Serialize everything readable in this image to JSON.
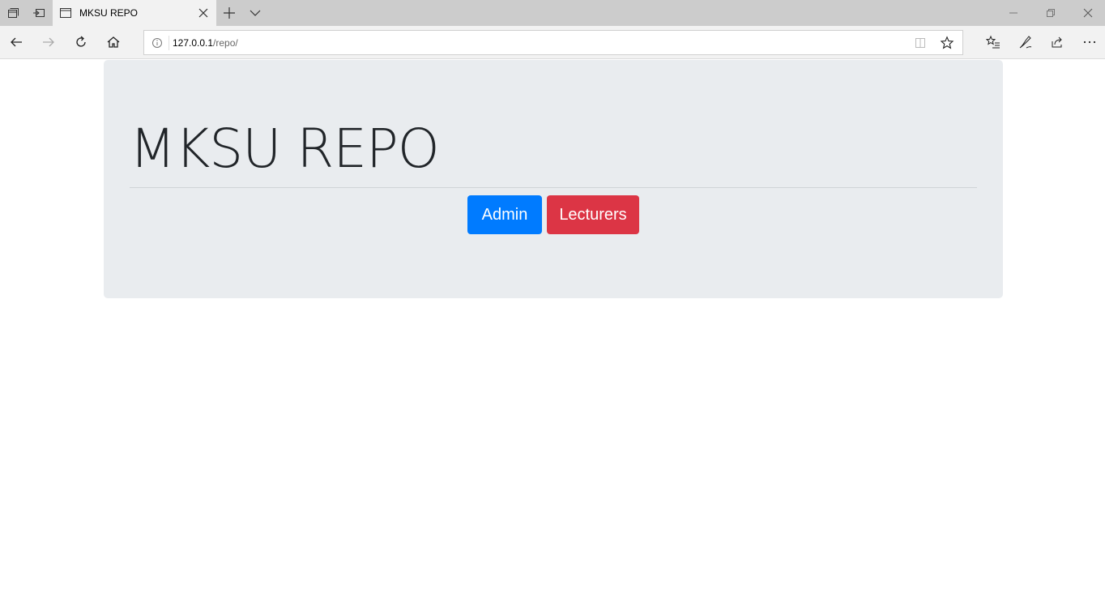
{
  "browser": {
    "tab": {
      "title": "MKSU REPO"
    },
    "address": {
      "host": "127.0.0.1",
      "path": "/repo/"
    },
    "icons": {
      "tab_actions": "tab-manager-icon",
      "set_aside": "set-aside-tabs-icon",
      "page": "page-icon",
      "close_tab": "close-icon",
      "new_tab": "plus-icon",
      "tab_list": "chevron-down-icon",
      "minimize": "minimize-icon",
      "restore": "restore-icon",
      "close_window": "close-icon",
      "back": "back-arrow-icon",
      "forward": "forward-arrow-icon",
      "refresh": "refresh-icon",
      "home": "home-icon",
      "site_info": "info-icon",
      "reading_view": "book-icon",
      "favorite": "star-icon",
      "favorites_hub": "favorites-list-icon",
      "notes": "pen-icon",
      "share": "share-icon",
      "more": "ellipsis-icon"
    }
  },
  "page": {
    "heading": "MKSU REPO",
    "buttons": {
      "admin": "Admin",
      "lecturers": "Lecturers"
    },
    "colors": {
      "jumbotron_bg": "#e9ecef",
      "admin_btn": "#007bff",
      "lecturers_btn": "#dc3545",
      "heading_text": "#212529"
    }
  }
}
